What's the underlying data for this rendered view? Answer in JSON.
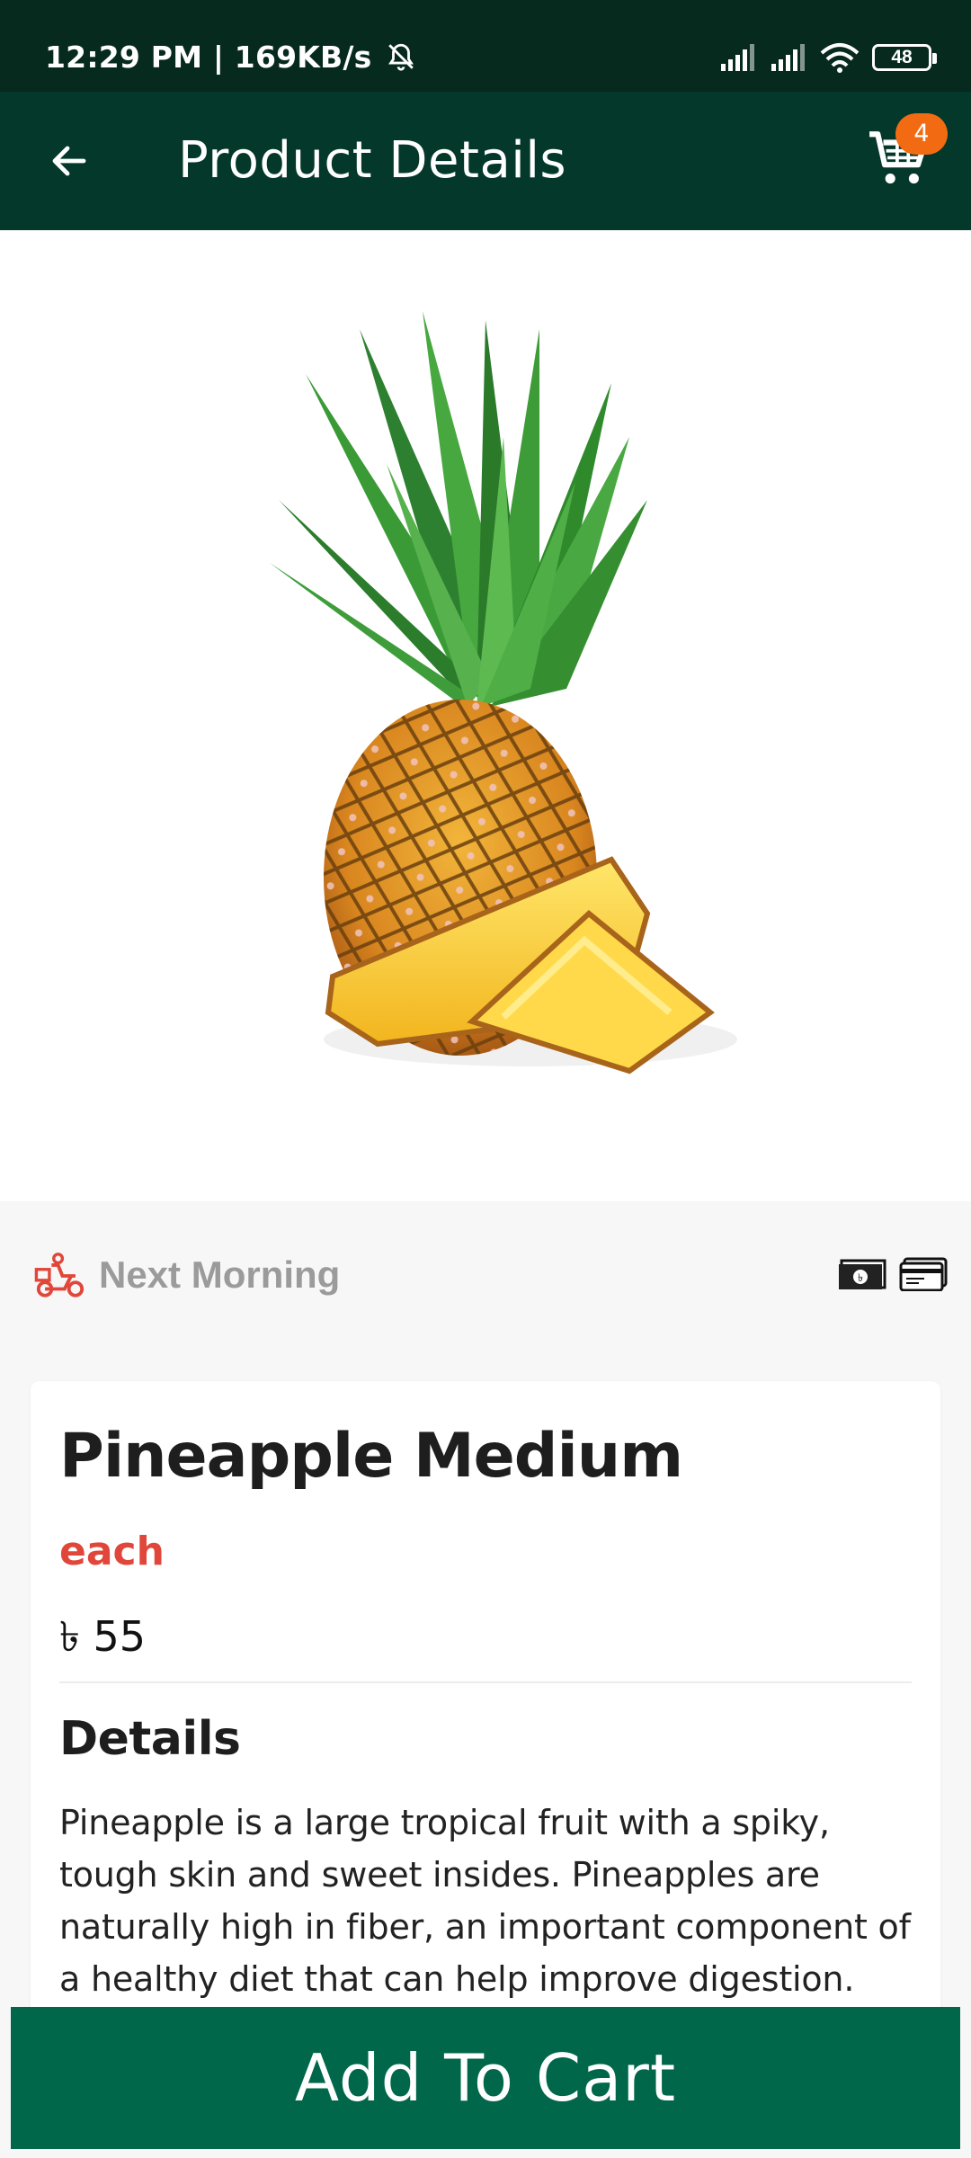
{
  "status_bar": {
    "time_speed": "12:29 PM | 169KB/s",
    "battery": "48"
  },
  "app_bar": {
    "title": "Product Details",
    "cart_count": "4"
  },
  "delivery": {
    "label": "Next Morning",
    "icons": [
      "scooter-icon",
      "cash-icon",
      "card-icon"
    ]
  },
  "product": {
    "name": "Pineapple Medium",
    "unit": "each",
    "price": "৳ 55",
    "details_heading": "Details",
    "details_text": "Pineapple is a large tropical fruit with a spiky, tough skin and sweet insides. Pineapples are naturally high in fiber, an important component of a healthy diet that can help improve digestion."
  },
  "actions": {
    "add_to_cart": "Add To Cart"
  },
  "colors": {
    "status_bar": "#062a1e",
    "app_bar": "#03382a",
    "badge": "#f26b12",
    "unit": "#e0473a",
    "button": "#00674a"
  }
}
